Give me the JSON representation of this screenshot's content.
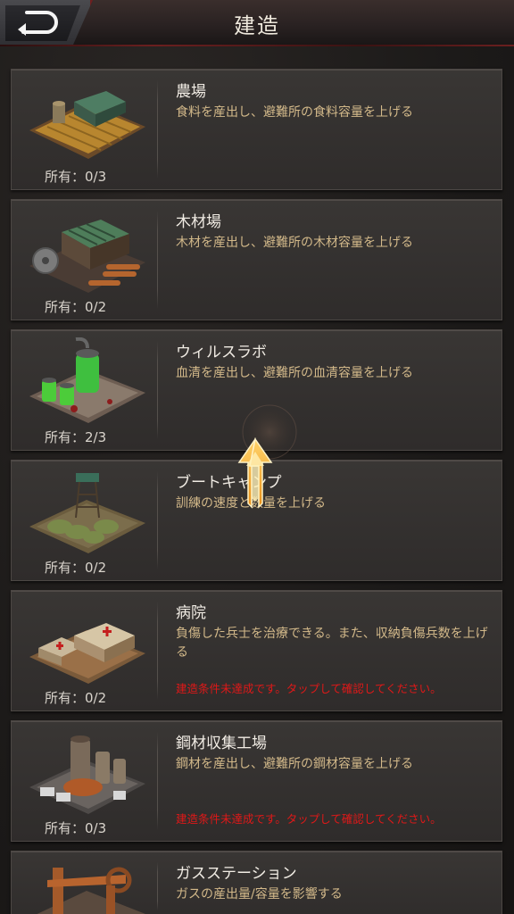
{
  "header": {
    "title": "建造",
    "back_icon": "back-arrow-icon"
  },
  "buildings": [
    {
      "name": "農場",
      "desc": "食料を産出し、避難所の食料容量を上げる",
      "owned": "所有：0/3",
      "warning": ""
    },
    {
      "name": "木材場",
      "desc": "木材を産出し、避難所の木材容量を上げる",
      "owned": "所有：0/2",
      "warning": ""
    },
    {
      "name": "ウィルスラボ",
      "desc": "血清を産出し、避難所の血清容量を上げる",
      "owned": "所有：2/3",
      "warning": ""
    },
    {
      "name": "ブートキャンプ",
      "desc": "訓練の速度と数量を上げる",
      "owned": "所有：0/2",
      "warning": ""
    },
    {
      "name": "病院",
      "desc": "負傷した兵士を治療できる。また、収納負傷兵数を上げる",
      "owned": "所有：0/2",
      "warning": "建造条件未達成です。タップして確認してください。"
    },
    {
      "name": "鋼材収集工場",
      "desc": "鋼材を産出し、避難所の鋼材容量を上げる",
      "owned": "所有：0/3",
      "warning": "建造条件未達成です。タップして確認してください。"
    },
    {
      "name": "ガスステーション",
      "desc": "ガスの産出量/容量を影響する",
      "owned": "",
      "warning": ""
    }
  ],
  "colors": {
    "warning": "#e01818",
    "description": "#d3b98a",
    "accent_red": "#6e1f1f",
    "tutorial_arrow": "#f0a830"
  }
}
